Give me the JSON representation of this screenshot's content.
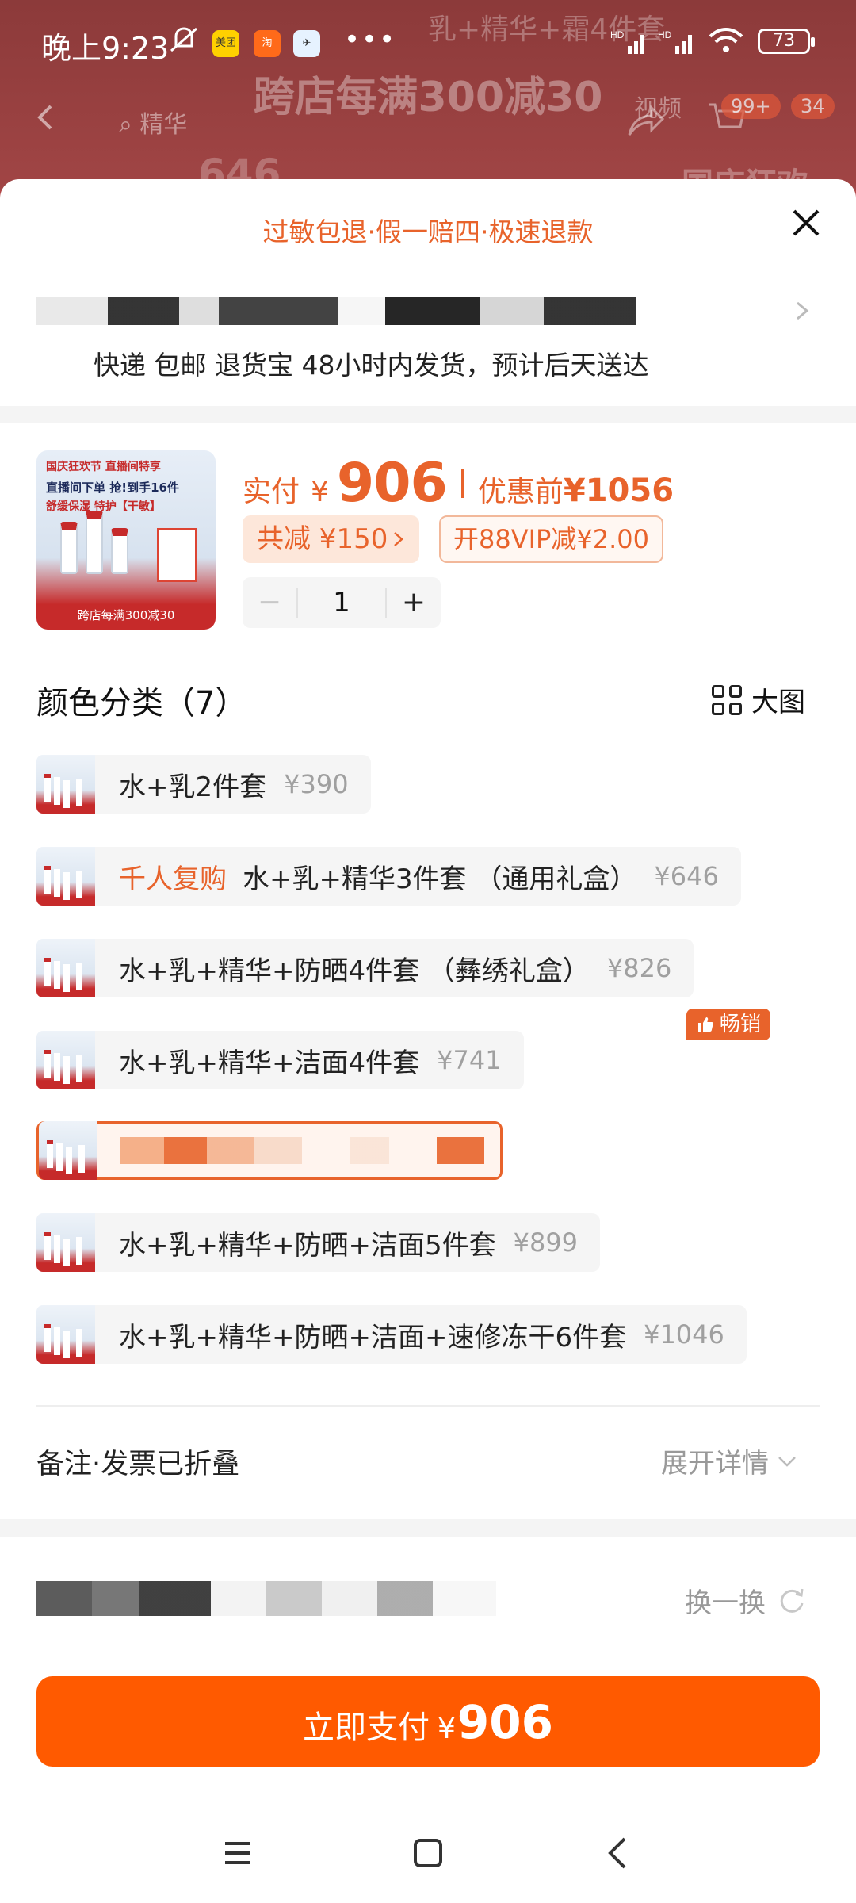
{
  "status_bar": {
    "time": "晚上9:23",
    "apps": [
      "美团"
    ],
    "battery": "73"
  },
  "background": {
    "banner": "跨店每满300减30",
    "ghost_tip": "乳+精华+霜4件套",
    "search_hint": "精华",
    "video_tab": "视频",
    "cart_badge": "99+",
    "msg_badge": "34",
    "price_ghost": "646",
    "right_ghost": "国庆狂欢"
  },
  "sheet": {
    "guarantee": "过敏包退·假一赔四·极速退款",
    "delivery": "快递 包邮 退货宝 48小时内发货，预计后天送达",
    "product": {
      "thumb_line1": "国庆狂欢节  直播间特享",
      "thumb_line2": "直播间下单 抢!到手16件",
      "thumb_line3": "舒缓保湿 特护【干敏】",
      "thumb_footer": "跨店每满300减30",
      "pay_label": "实付",
      "currency": "¥",
      "pay_amount": "906",
      "orig_label": "优惠前",
      "orig_amount": "¥1056",
      "discount": "共减 ¥150",
      "vip": "开88VIP减¥2.00",
      "quantity": "1",
      "minus": "−",
      "plus": "+"
    },
    "variants_title": "颜色分类（7）",
    "big_image_label": "大图",
    "hot_badge": "畅销",
    "variants": [
      {
        "name": "水+乳2件套",
        "price": "¥390"
      },
      {
        "tag": "千人复购",
        "name": "水+乳+精华3件套 （通用礼盒）",
        "price": "¥646"
      },
      {
        "name": "水+乳+精华+防晒4件套 （彝绣礼盒）",
        "price": "¥826"
      },
      {
        "name": "水+乳+精华+洁面4件套",
        "price": "¥741"
      },
      {
        "name": "",
        "price": "",
        "selected": true
      },
      {
        "name": "水+乳+精华+防晒+洁面5件套",
        "price": "¥899"
      },
      {
        "name": "水+乳+精华+防晒+洁面+速修冻干6件套",
        "price": "¥1046"
      }
    ],
    "remark": "备注·发票已折叠",
    "expand": "展开详情",
    "swap": "换一换",
    "pay_button": {
      "label": "立即支付",
      "currency": "¥",
      "amount": "906"
    }
  },
  "colors": {
    "accent": "#e8632b",
    "pay_button": "#ff5a00"
  }
}
